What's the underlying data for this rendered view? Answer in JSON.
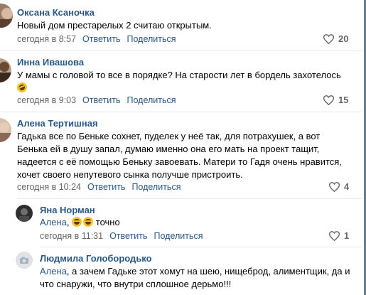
{
  "comments": [
    {
      "author": "Оксана Ксаночка",
      "text": "Новый дом престарелых 2 считаю открытым.",
      "date": "сегодня в 8:57",
      "reply_label": "Ответить",
      "share_label": "Поделиться",
      "likes": "20"
    },
    {
      "author": "Инна Ивашова",
      "text": "У мамы с головой то все в порядке? На старости лет в бордель захотелось",
      "date": "сегодня в 9:03",
      "reply_label": "Ответить",
      "share_label": "Поделиться",
      "likes": "15"
    },
    {
      "author": "Алена Тертишная",
      "text": "Гадька все по Беньке сохнет, пуделек у неё так, для потрахушек, а вот Бенька ей в душу запал, думаю именно она его мать на проект тащит, надеется с её помощью Беньку завоевать. Матери то Гадя очень нравится, хочет своего непутевого сынка получше пристроить.",
      "date": "сегодня в 10:24",
      "reply_label": "Ответить",
      "share_label": "Поделиться",
      "likes": "4"
    },
    {
      "author": "Яна Норман",
      "mention": "Алена",
      "text_after": "точно",
      "date": "сегодня в 11:31",
      "reply_label": "Ответить",
      "share_label": "Поделиться",
      "likes": "1"
    },
    {
      "author": "Людмила Голобородько",
      "mention": "Алена",
      "text_after": ", а зачем Гадьке этот хомут на шею, нищеброд, алиментщик, да и что снаружи, что внутри сплошное дерьмо!!!"
    }
  ],
  "icons": {
    "like": "heart-icon",
    "camera": "camera-icon",
    "emoji": "laughing-emoji-icon"
  },
  "colors": {
    "link": "#2a5885",
    "meta": "#656565",
    "separator": "#e7e8ec"
  }
}
